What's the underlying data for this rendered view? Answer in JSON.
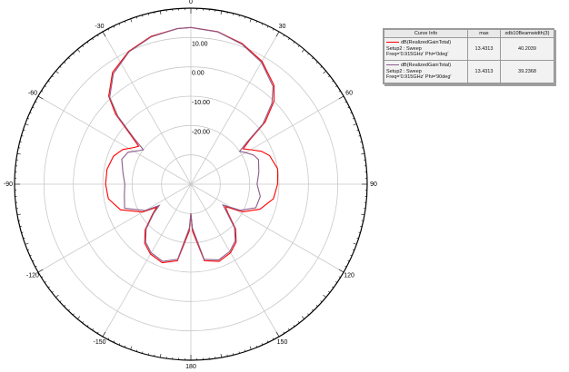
{
  "chart_data": {
    "type": "polar",
    "angle_unit": "deg",
    "angle_ticks": [
      0,
      30,
      60,
      90,
      120,
      150,
      180,
      -150,
      -120,
      -90,
      -60,
      -30
    ],
    "radial_ticks": [
      10,
      0,
      -10,
      -20
    ],
    "radial_tick_labels": [
      "10.00",
      "0.00",
      "-10.00",
      "-20.00"
    ],
    "rlim": [
      -40,
      20
    ],
    "grid": true,
    "legend_position": "top-right",
    "series": [
      {
        "name": "dB(RealizedGainTotal)",
        "setup": "Setup2 : Sweep",
        "params": "Freq='0.915GHz' Phi='0deg'",
        "color": "#ff0000",
        "max": "13.4313",
        "beamwidth": "40.2039",
        "points": [
          [
            0,
            13.4
          ],
          [
            10,
            12.8
          ],
          [
            20,
            11.0
          ],
          [
            30,
            8.4
          ],
          [
            40,
            4.0
          ],
          [
            45,
            0.0
          ],
          [
            50,
            -7.0
          ],
          [
            53,
            -15.0
          ],
          [
            56,
            -18.5
          ],
          [
            60,
            -16.5
          ],
          [
            65,
            -13.5
          ],
          [
            70,
            -11.5
          ],
          [
            80,
            -10.0
          ],
          [
            90,
            -10.5
          ],
          [
            100,
            -11.5
          ],
          [
            110,
            -15.0
          ],
          [
            118,
            -20.0
          ],
          [
            123,
            -26.0
          ],
          [
            128,
            -24.0
          ],
          [
            135,
            -18.5
          ],
          [
            142,
            -15.0
          ],
          [
            150,
            -13.0
          ],
          [
            160,
            -12.0
          ],
          [
            170,
            -13.5
          ],
          [
            178,
            -24.0
          ],
          [
            180,
            -30.0
          ],
          [
            182,
            -24.0
          ],
          [
            190,
            -13.5
          ],
          [
            200,
            -11.5
          ],
          [
            210,
            -12.5
          ],
          [
            218,
            -14.5
          ],
          [
            225,
            -18.0
          ],
          [
            232,
            -23.5
          ],
          [
            236,
            -26.0
          ],
          [
            240,
            -21.0
          ],
          [
            250,
            -14.5
          ],
          [
            260,
            -11.5
          ],
          [
            270,
            -11.0
          ],
          [
            280,
            -11.0
          ],
          [
            290,
            -12.0
          ],
          [
            297,
            -14.0
          ],
          [
            303,
            -17.0
          ],
          [
            306,
            -18.0
          ],
          [
            309,
            -14.0
          ],
          [
            313,
            -5.0
          ],
          [
            317,
            1.0
          ],
          [
            325,
            6.5
          ],
          [
            335,
            10.0
          ],
          [
            345,
            12.2
          ],
          [
            355,
            13.2
          ],
          [
            360,
            13.4
          ]
        ]
      },
      {
        "name": "dB(RealizedGainTotal)",
        "setup": "Setup2 : Sweep",
        "params": "Freq='0.915GHz' Phi='90deg'",
        "color": "#8a5c8a",
        "max": "13.4313",
        "beamwidth": "39.2368",
        "points": [
          [
            0,
            13.4
          ],
          [
            10,
            12.7
          ],
          [
            20,
            10.8
          ],
          [
            30,
            8.0
          ],
          [
            40,
            3.5
          ],
          [
            45,
            -1.0
          ],
          [
            50,
            -8.0
          ],
          [
            53,
            -16.0
          ],
          [
            56,
            -20.0
          ],
          [
            60,
            -18.5
          ],
          [
            65,
            -16.5
          ],
          [
            70,
            -15.5
          ],
          [
            80,
            -16.5
          ],
          [
            90,
            -17.5
          ],
          [
            100,
            -16.0
          ],
          [
            110,
            -16.5
          ],
          [
            118,
            -21.0
          ],
          [
            123,
            -27.0
          ],
          [
            128,
            -24.5
          ],
          [
            135,
            -19.0
          ],
          [
            142,
            -15.5
          ],
          [
            150,
            -13.5
          ],
          [
            160,
            -12.5
          ],
          [
            170,
            -14.0
          ],
          [
            178,
            -25.0
          ],
          [
            180,
            -30.0
          ],
          [
            182,
            -25.0
          ],
          [
            190,
            -14.0
          ],
          [
            200,
            -12.0
          ],
          [
            210,
            -13.0
          ],
          [
            218,
            -15.0
          ],
          [
            225,
            -18.5
          ],
          [
            232,
            -24.0
          ],
          [
            236,
            -27.0
          ],
          [
            240,
            -22.0
          ],
          [
            250,
            -16.0
          ],
          [
            260,
            -17.0
          ],
          [
            270,
            -17.5
          ],
          [
            280,
            -16.5
          ],
          [
            290,
            -15.0
          ],
          [
            297,
            -16.0
          ],
          [
            303,
            -19.0
          ],
          [
            306,
            -20.0
          ],
          [
            309,
            -15.0
          ],
          [
            313,
            -6.0
          ],
          [
            317,
            0.5
          ],
          [
            325,
            6.0
          ],
          [
            335,
            9.8
          ],
          [
            345,
            12.0
          ],
          [
            355,
            13.2
          ],
          [
            360,
            13.4
          ]
        ]
      }
    ],
    "legend_headers": {
      "curve": "Curve Info",
      "max": "max",
      "beamwidth": "xdb10Beamwidth(3)"
    }
  }
}
